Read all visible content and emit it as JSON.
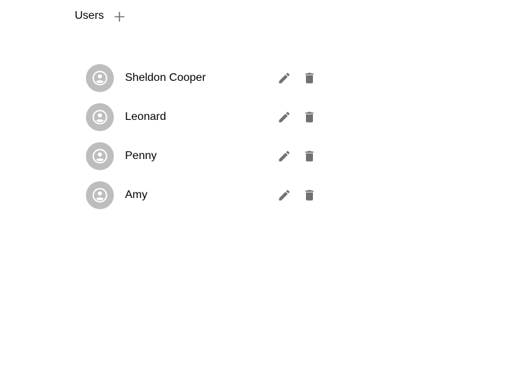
{
  "header": {
    "title": "Users",
    "add_icon": "plus-icon"
  },
  "colors": {
    "avatar_bg": "#bdbdbd",
    "icon": "#707070",
    "text": "#000000"
  },
  "users": [
    {
      "name": "Sheldon Cooper",
      "avatar_icon": "account-circle-icon",
      "edit_icon": "pencil-icon",
      "delete_icon": "trash-icon"
    },
    {
      "name": "Leonard",
      "avatar_icon": "account-circle-icon",
      "edit_icon": "pencil-icon",
      "delete_icon": "trash-icon"
    },
    {
      "name": "Penny",
      "avatar_icon": "account-circle-icon",
      "edit_icon": "pencil-icon",
      "delete_icon": "trash-icon"
    },
    {
      "name": "Amy",
      "avatar_icon": "account-circle-icon",
      "edit_icon": "pencil-icon",
      "delete_icon": "trash-icon"
    }
  ]
}
